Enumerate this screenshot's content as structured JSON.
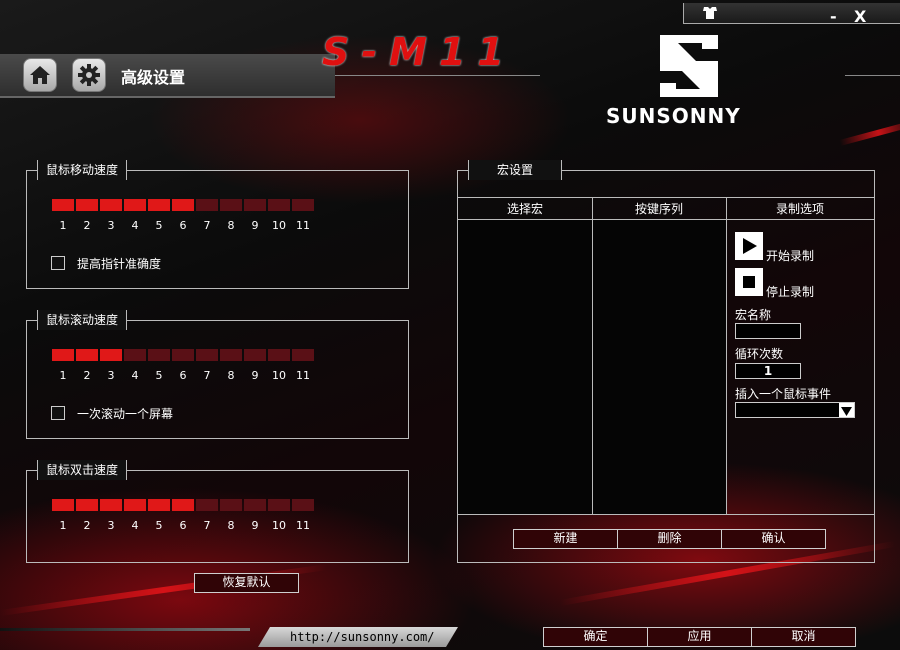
{
  "window": {
    "minimize_label": "-",
    "close_label": "X",
    "app_icon": "tshirt-icon"
  },
  "header": {
    "page_title": "高级设置",
    "brand_title": "S-M11",
    "logo_text": "SUNSONNY",
    "home_icon": "home-icon",
    "settings_icon": "gear-icon"
  },
  "mouse_speed": {
    "title": "鼠标移动速度",
    "level": 6,
    "max": 11,
    "ticks": [
      "1",
      "2",
      "3",
      "4",
      "5",
      "6",
      "7",
      "8",
      "9",
      "10",
      "11"
    ],
    "checkbox_label": "提高指针准确度",
    "checked": false
  },
  "scroll_speed": {
    "title": "鼠标滚动速度",
    "level": 3,
    "max": 11,
    "ticks": [
      "1",
      "2",
      "3",
      "4",
      "5",
      "6",
      "7",
      "8",
      "9",
      "10",
      "11"
    ],
    "checkbox_label": "一次滚动一个屏幕",
    "checked": false
  },
  "double_click_speed": {
    "title": "鼠标双击速度",
    "level": 6,
    "max": 11,
    "ticks": [
      "1",
      "2",
      "3",
      "4",
      "5",
      "6",
      "7",
      "8",
      "9",
      "10",
      "11"
    ]
  },
  "restore_default_label": "恢复默认",
  "macro": {
    "title": "宏设置",
    "columns": [
      "选择宏",
      "按键序列",
      "录制选项"
    ],
    "start_record_label": "开始录制",
    "stop_record_label": "停止录制",
    "macro_name_label": "宏名称",
    "macro_name_value": "",
    "loop_count_label": "循环次数",
    "loop_count_value": "1",
    "insert_event_label": "插入一个鼠标事件",
    "new_label": "新建",
    "delete_label": "删除",
    "confirm_label": "确认"
  },
  "footer": {
    "url": "http://sunsonny.com/",
    "ok_label": "确定",
    "apply_label": "应用",
    "cancel_label": "取消"
  },
  "colors": {
    "accent": "#e01818",
    "inactive_segment": "#5a1016",
    "button_bg": "#300406"
  }
}
